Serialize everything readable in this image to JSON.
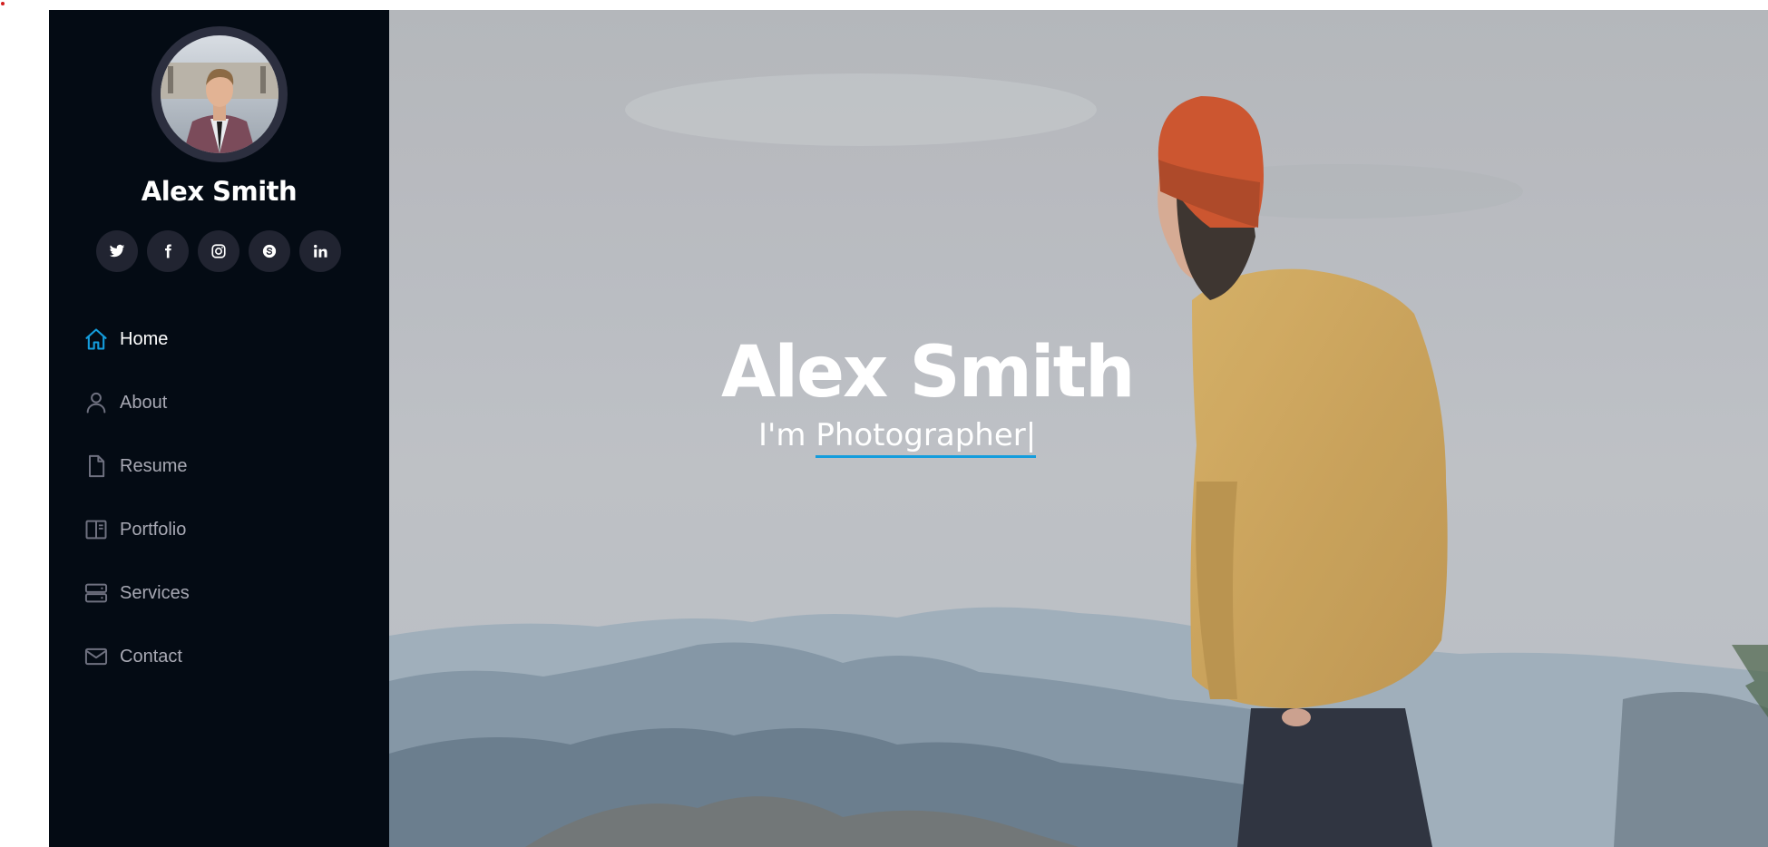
{
  "profile": {
    "name": "Alex Smith"
  },
  "socials": [
    {
      "icon": "twitter-icon"
    },
    {
      "icon": "facebook-icon"
    },
    {
      "icon": "instagram-icon"
    },
    {
      "icon": "skype-icon"
    },
    {
      "icon": "linkedin-icon"
    }
  ],
  "nav": {
    "items": [
      {
        "label": "Home",
        "icon": "home-icon",
        "active": true
      },
      {
        "label": "About",
        "icon": "person-icon"
      },
      {
        "label": "Resume",
        "icon": "file-icon"
      },
      {
        "label": "Portfolio",
        "icon": "book-icon"
      },
      {
        "label": "Services",
        "icon": "server-icon"
      },
      {
        "label": "Contact",
        "icon": "envelope-icon"
      }
    ]
  },
  "hero": {
    "title": "Alex Smith",
    "prefix": "I'm",
    "typed": "Photographer",
    "cursor": "|"
  },
  "colors": {
    "sidebar_bg": "#040b14",
    "social_bg": "#212431",
    "accent": "#149ddd",
    "nav_text": "#a8a9b4"
  }
}
